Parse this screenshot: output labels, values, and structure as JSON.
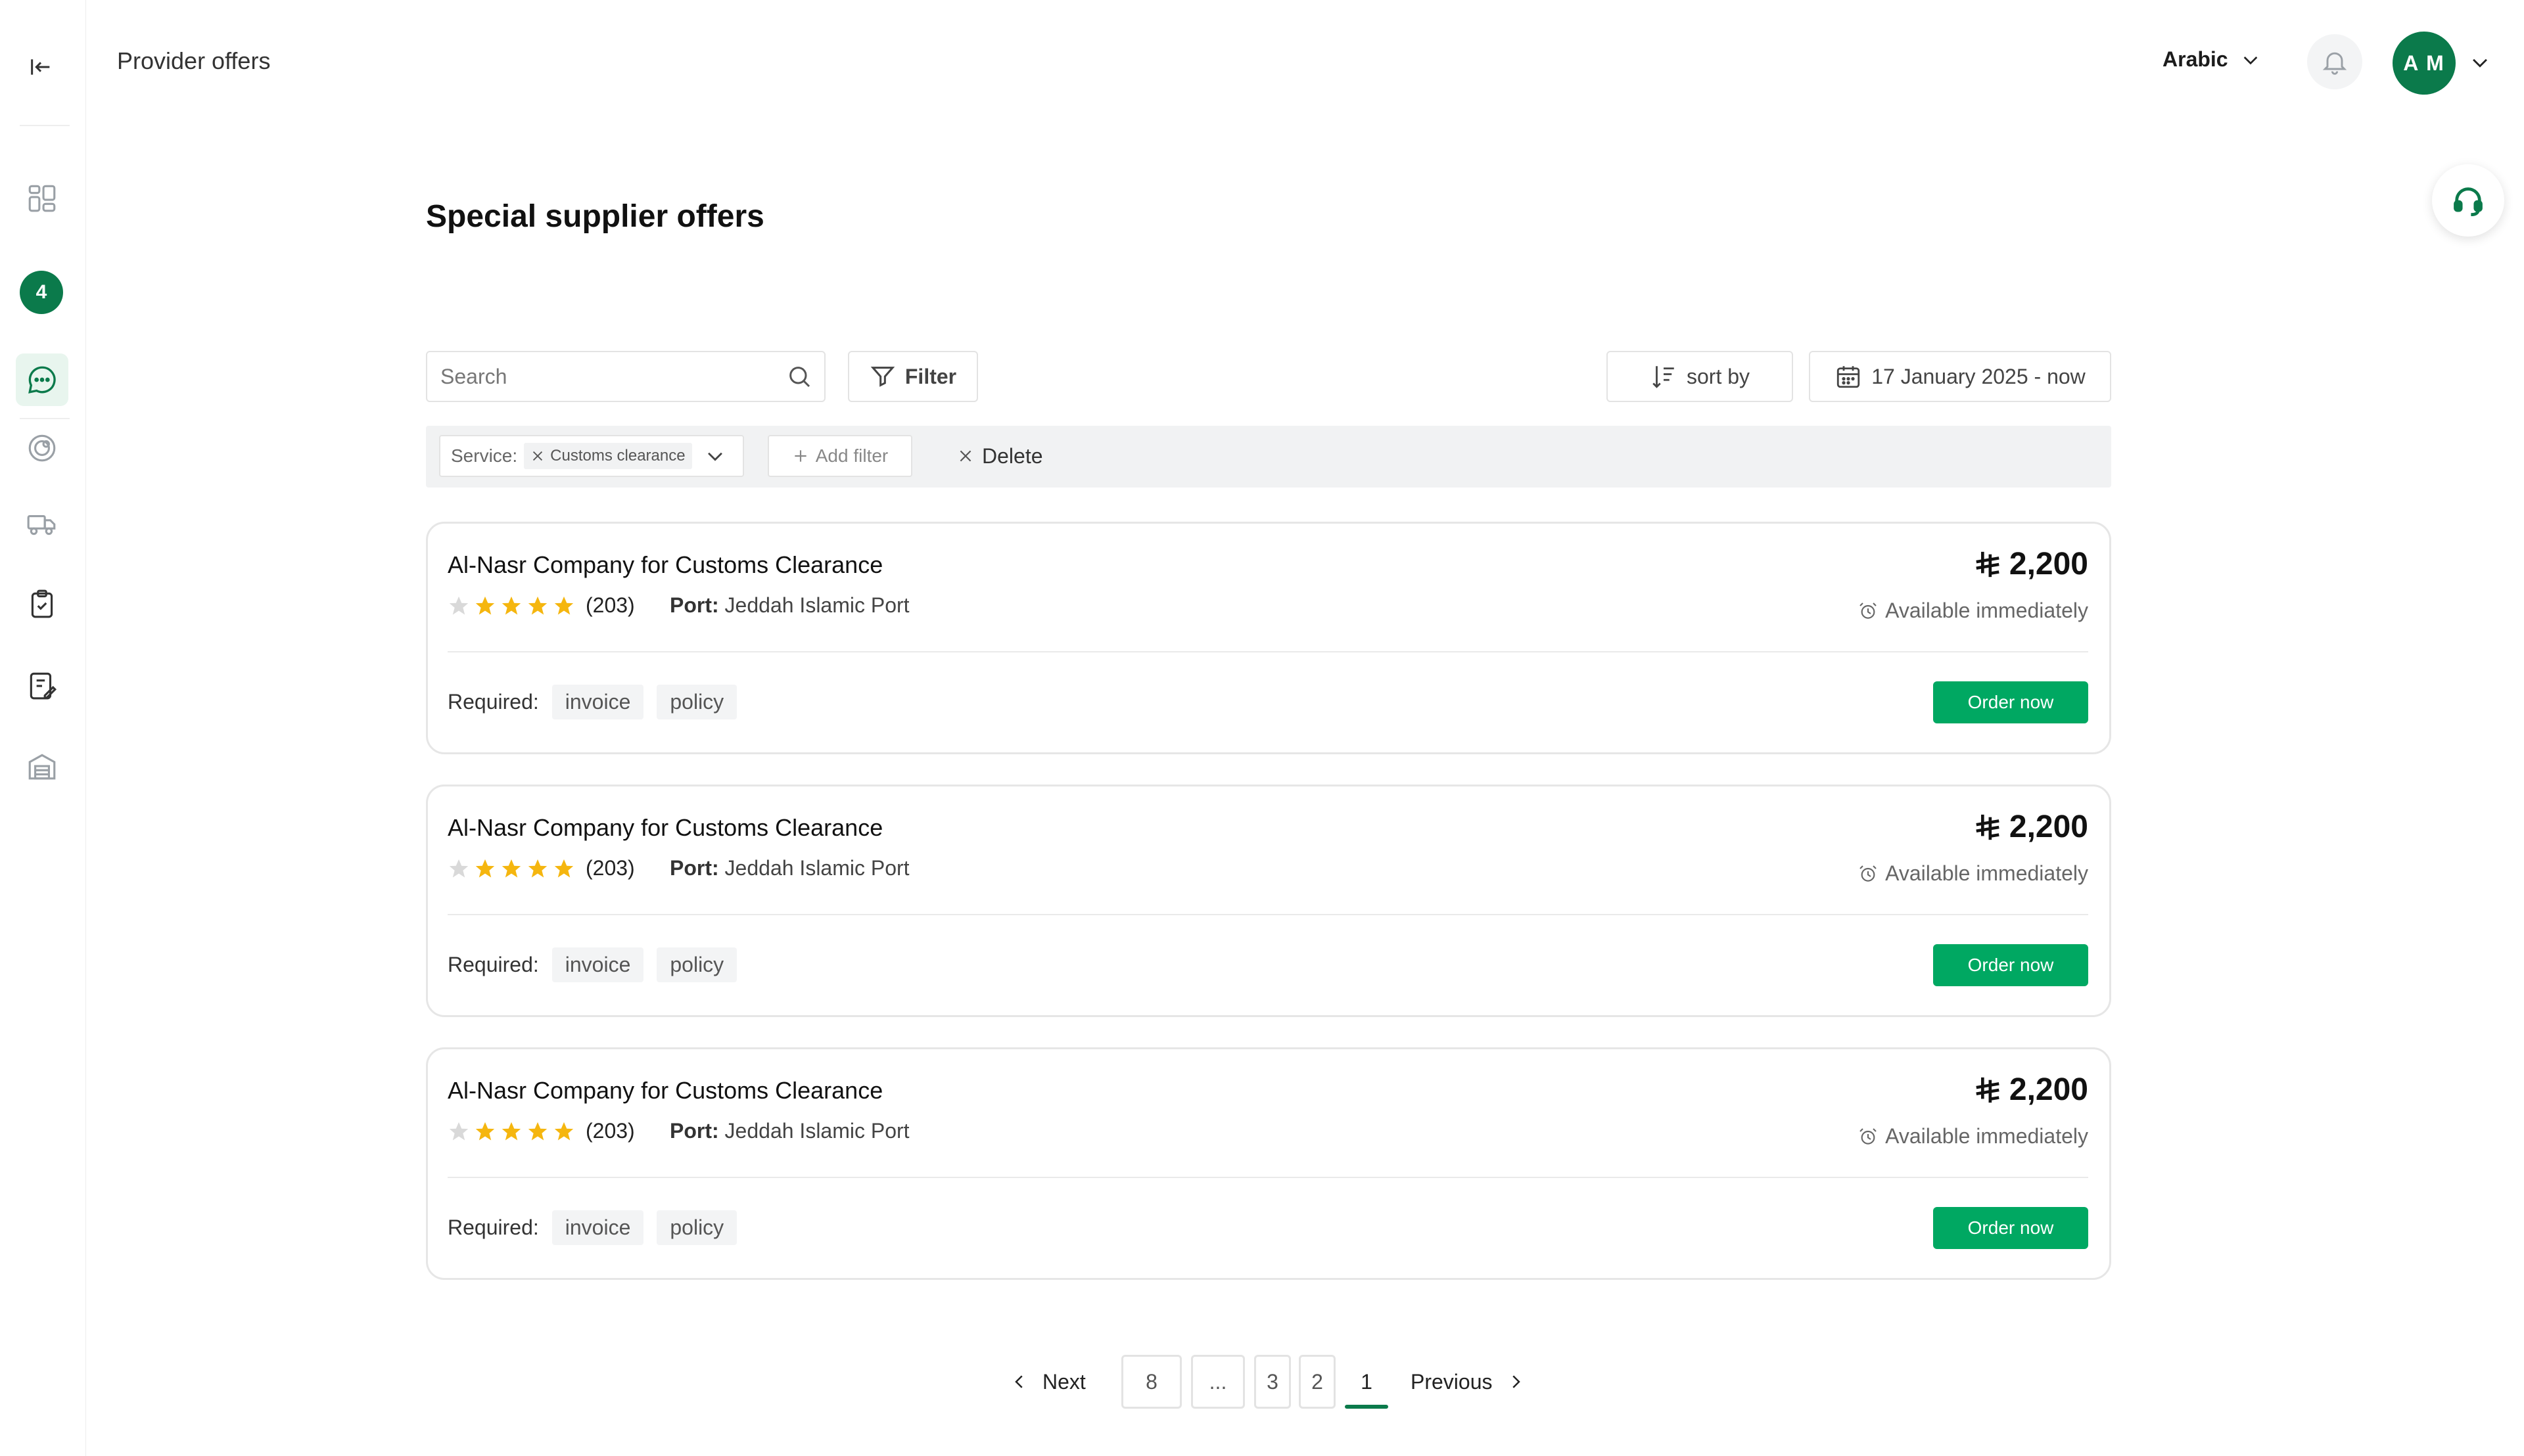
{
  "header": {
    "page_title": "Provider offers",
    "language": "Arabic",
    "avatar_initials": "A M"
  },
  "sidebar": {
    "badge_count": "4",
    "items": [
      "dashboard-icon",
      "chat-icon",
      "radar-icon",
      "truck-icon",
      "clipboard-check-icon",
      "edit-document-icon",
      "warehouse-icon"
    ]
  },
  "main": {
    "heading": "Special supplier offers",
    "search_placeholder": "Search",
    "filter_label": "Filter",
    "sort_label": "sort by",
    "date_range": "17 January 2025 - now",
    "active_filter": {
      "label": "Service:",
      "value": "Customs clearance"
    },
    "add_filter_label": "Add filter",
    "delete_label": "Delete"
  },
  "offers": [
    {
      "name": "Al-Nasr Company for Customs Clearance",
      "rating_count": "(203)",
      "stars_filled": 4,
      "stars_total": 5,
      "port_label": "Port:",
      "port_value": "Jeddah Islamic Port",
      "price": "2,200",
      "availability": "Available immediately",
      "required_label": "Required:",
      "tags": [
        "invoice",
        "policy"
      ],
      "order_label": "Order now"
    },
    {
      "name": "Al-Nasr Company for Customs Clearance",
      "rating_count": "(203)",
      "stars_filled": 4,
      "stars_total": 5,
      "port_label": "Port:",
      "port_value": "Jeddah Islamic Port",
      "price": "2,200",
      "availability": "Available immediately",
      "required_label": "Required:",
      "tags": [
        "invoice",
        "policy"
      ],
      "order_label": "Order now"
    },
    {
      "name": "Al-Nasr Company for Customs Clearance",
      "rating_count": "(203)",
      "stars_filled": 4,
      "stars_total": 5,
      "port_label": "Port:",
      "port_value": "Jeddah Islamic Port",
      "price": "2,200",
      "availability": "Available immediately",
      "required_label": "Required:",
      "tags": [
        "invoice",
        "policy"
      ],
      "order_label": "Order now"
    }
  ],
  "pagination": {
    "next_label": "Next",
    "previous_label": "Previous",
    "pages": [
      "8",
      "...",
      "3",
      "2"
    ],
    "current": "1"
  },
  "colors": {
    "brand_green": "#0b7a4b",
    "button_green": "#00a862",
    "star": "#f5b60f",
    "star_empty": "#d9d9d9"
  }
}
